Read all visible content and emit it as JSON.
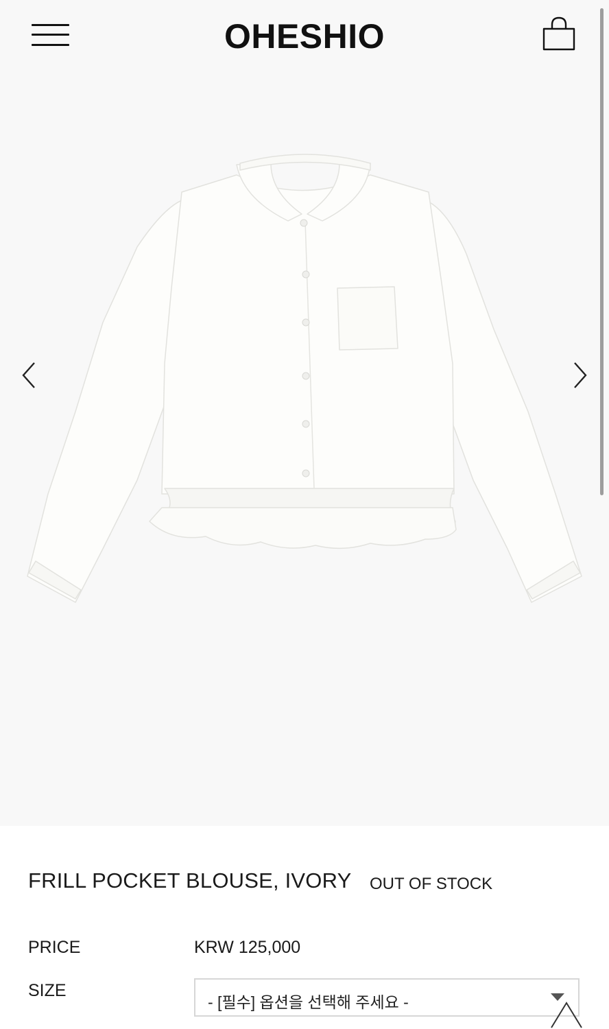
{
  "header": {
    "logo": "OHESHIO",
    "menu_icon": "hamburger-menu-icon",
    "cart_icon": "shopping-bag-icon"
  },
  "gallery": {
    "image_alt": "Frill pocket blouse, ivory",
    "prev_icon": "chevron-left-icon",
    "next_icon": "chevron-right-icon"
  },
  "product": {
    "name": "FRILL POCKET BLOUSE, IVORY",
    "stock_status": "OUT OF STOCK",
    "price_label": "PRICE",
    "price": "KRW 125,000",
    "size_label": "SIZE",
    "size_select_value": "- [필수] 옵션을 선택해 주세요 -"
  },
  "colors": {
    "background": "#ffffff",
    "hero_background": "#f8f8f8",
    "text": "#1a1a1a",
    "blouse": "#fdfdfb"
  }
}
